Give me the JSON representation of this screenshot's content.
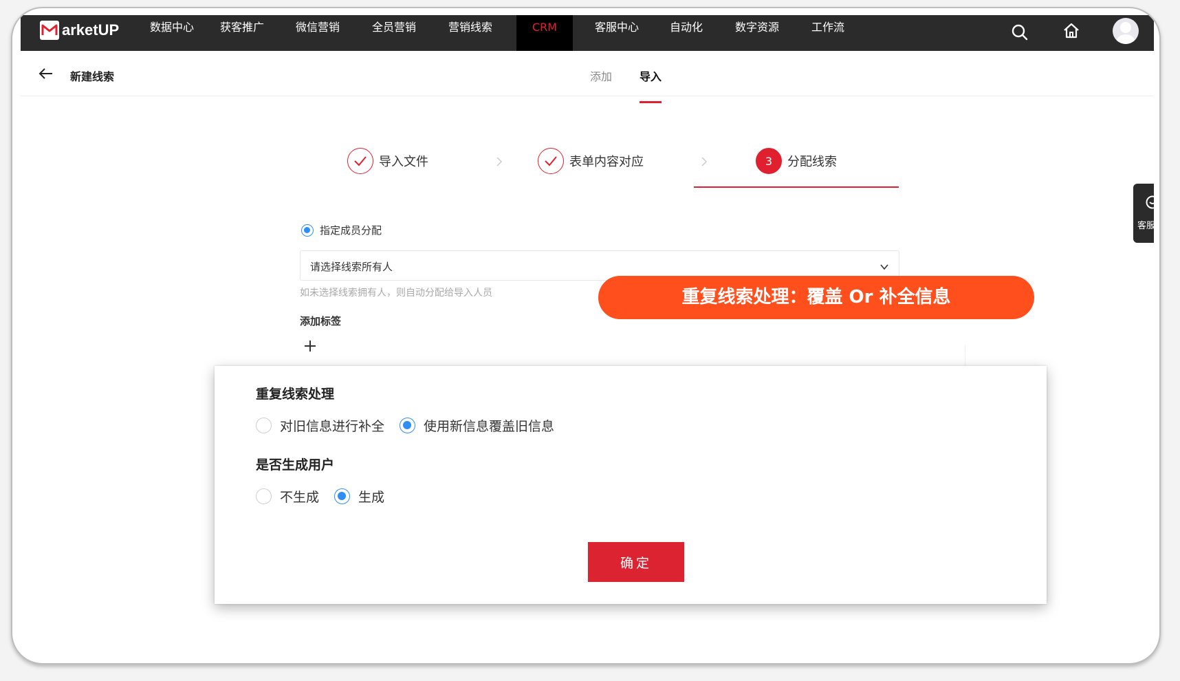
{
  "brand": {
    "logo_text": "arketUP",
    "accent": "#e0202f",
    "callout_color": "#fe4f1c"
  },
  "nav": {
    "items": [
      "数据中心",
      "获客推广",
      "微信营销",
      "全员营销",
      "营销线索",
      "CRM",
      "客服中心",
      "自动化",
      "数字资源",
      "工作流"
    ],
    "active": "CRM"
  },
  "subheader": {
    "title": "新建线索",
    "tabs": [
      "添加",
      "导入"
    ],
    "active_tab": "导入"
  },
  "steps": [
    {
      "label": "导入文件",
      "state": "done"
    },
    {
      "label": "表单内容对应",
      "state": "done"
    },
    {
      "label": "分配线索",
      "state": "current",
      "number": "3"
    }
  ],
  "assign": {
    "radio_label": "指定成员分配",
    "select_placeholder": "请选择线索所有人",
    "hint": "如未选择线索拥有人，则自动分配给导入人员",
    "tag_label": "添加标签"
  },
  "callout": {
    "text": "重复线索处理：覆盖 Or 补全信息"
  },
  "side_widget": {
    "label": "客服消息"
  },
  "panel": {
    "dup_title": "重复线索处理",
    "dup_options": [
      "对旧信息进行补全",
      "使用新信息覆盖旧信息"
    ],
    "dup_selected": "使用新信息覆盖旧信息",
    "user_title": "是否生成用户",
    "user_options": [
      "不生成",
      "生成"
    ],
    "user_selected": "生成",
    "confirm_label": "确定"
  }
}
